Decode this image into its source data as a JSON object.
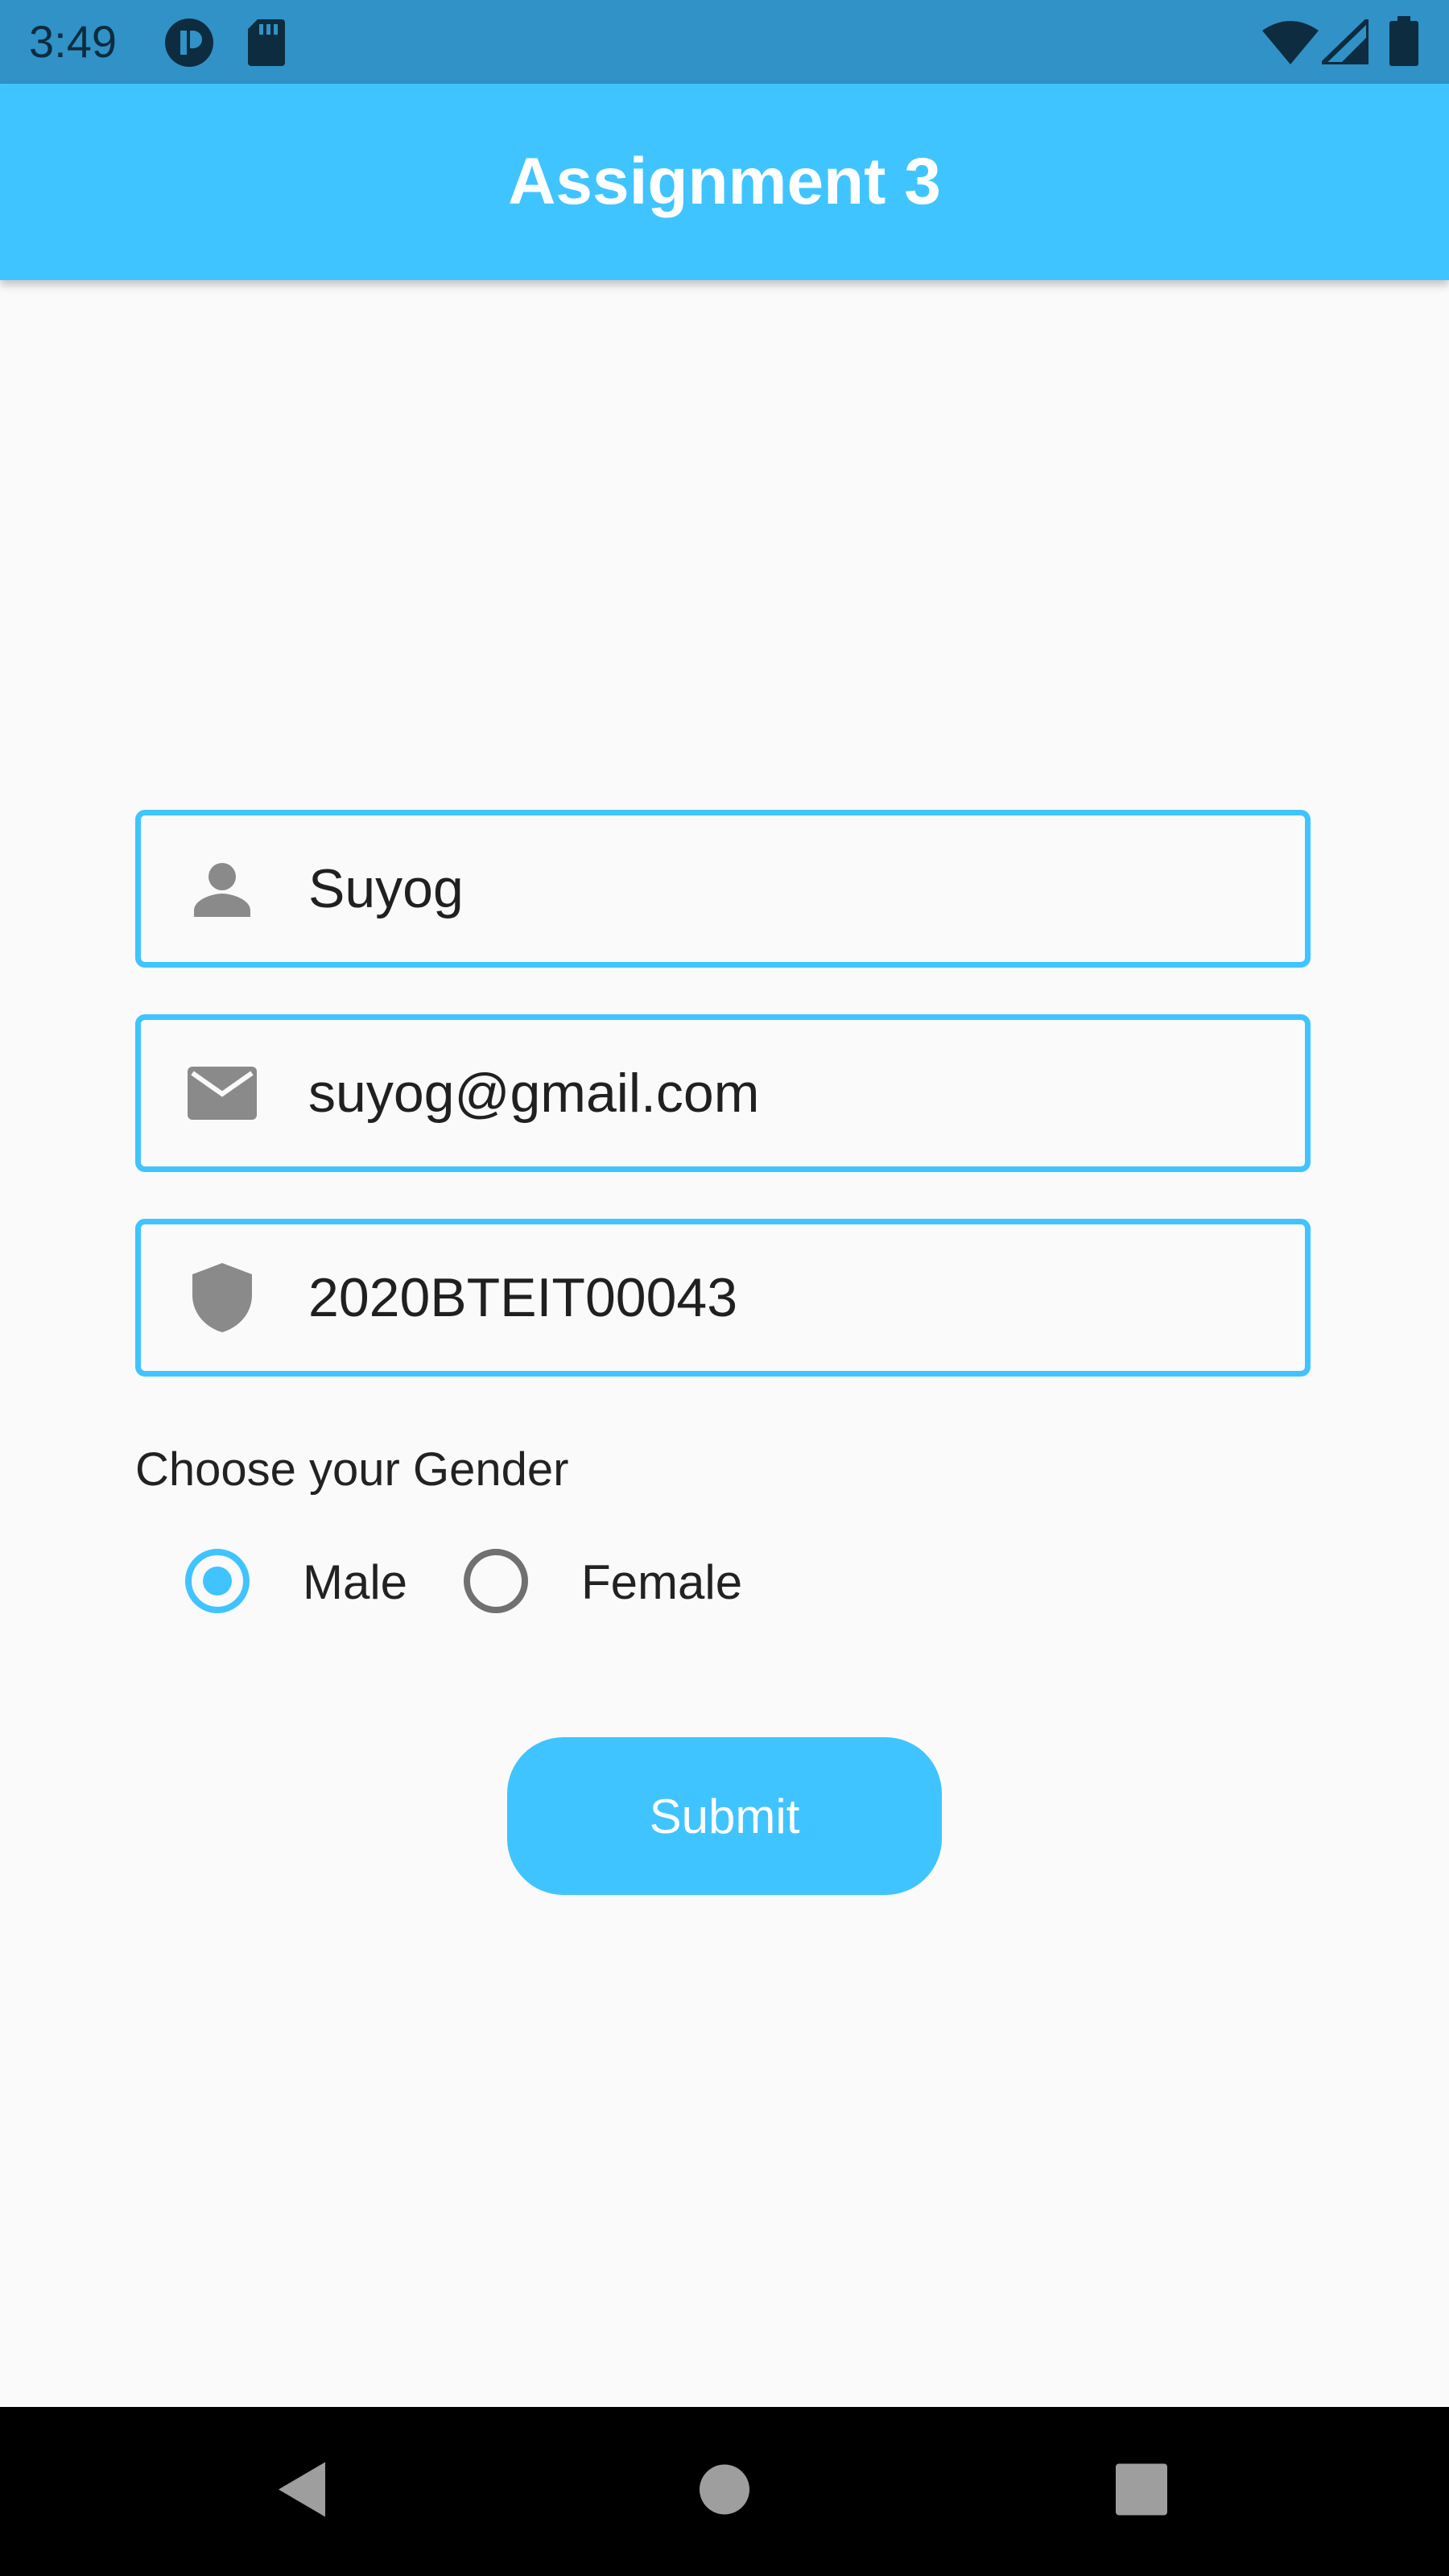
{
  "status_bar": {
    "time": "3:49",
    "icons": [
      "app-notification-icon",
      "sd-card-icon",
      "wifi-icon",
      "cell-signal-icon",
      "battery-icon"
    ]
  },
  "app_bar": {
    "title": "Assignment 3"
  },
  "form": {
    "name_field": {
      "icon": "person-icon",
      "value": "Suyog"
    },
    "email_field": {
      "icon": "email-icon",
      "value": "suyog@gmail.com"
    },
    "id_field": {
      "icon": "shield-icon",
      "value": "2020BTEIT00043"
    },
    "gender_prompt": "Choose your Gender",
    "gender_options": [
      {
        "label": "Male",
        "selected": true
      },
      {
        "label": "Female",
        "selected": false
      }
    ],
    "submit_label": "Submit"
  },
  "nav_bar": {
    "buttons": [
      "back-icon",
      "home-icon",
      "recents-icon"
    ]
  },
  "colors": {
    "accent": "#40c4ff",
    "status_bar": "#3092c6",
    "background": "#fafafa",
    "icon_gray": "#8a8a8a"
  }
}
